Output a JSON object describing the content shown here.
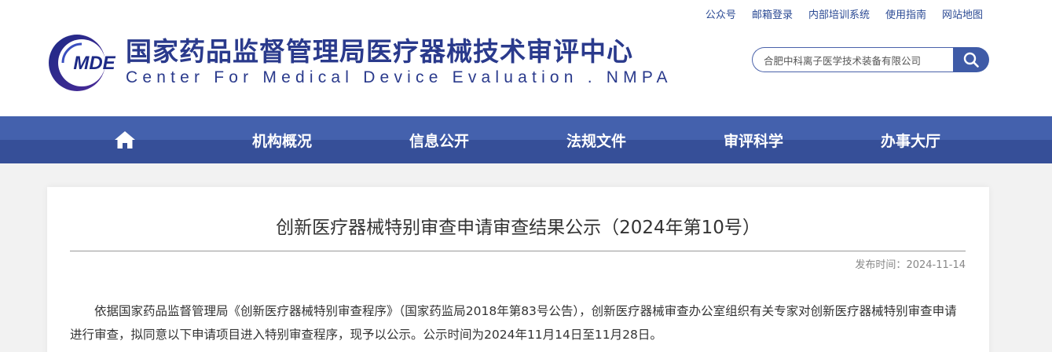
{
  "header": {
    "top_links": [
      "公众号",
      "邮箱登录",
      "内部培训系统",
      "使用指南",
      "网站地图"
    ],
    "logo_text": "MDE",
    "site_title": "国家药品监督管理局医疗器械技术审评中心",
    "site_subtitle": "Center For Medical Device Evaluation . NMPA",
    "search": {
      "value": "合肥中科离子医学技术装备有限公司",
      "icon": "search-icon"
    }
  },
  "nav": {
    "home_icon": "home-icon",
    "items": [
      "机构概况",
      "信息公开",
      "法规文件",
      "审评科学",
      "办事大厅"
    ]
  },
  "article": {
    "title": "创新医疗器械特别审查申请审查结果公示（2024年第10号）",
    "date_label": "发布时间：",
    "date": "2024-11-14",
    "body": "依据国家药品监督管理局《创新医疗器械特别审查程序》（国家药监局2018年第83号公告），创新医疗器械审查办公室组织有关专家对创新医疗器械特别审查申请进行审查，拟同意以下申请项目进入特别审查程序，现予以公示。公示时间为2024年11月14日至11月28日。"
  },
  "colors": {
    "brand": "#2a3a8c",
    "nav_top": "#4461ad",
    "nav_bottom": "#364f98",
    "search_button": "#3f5ba7"
  }
}
